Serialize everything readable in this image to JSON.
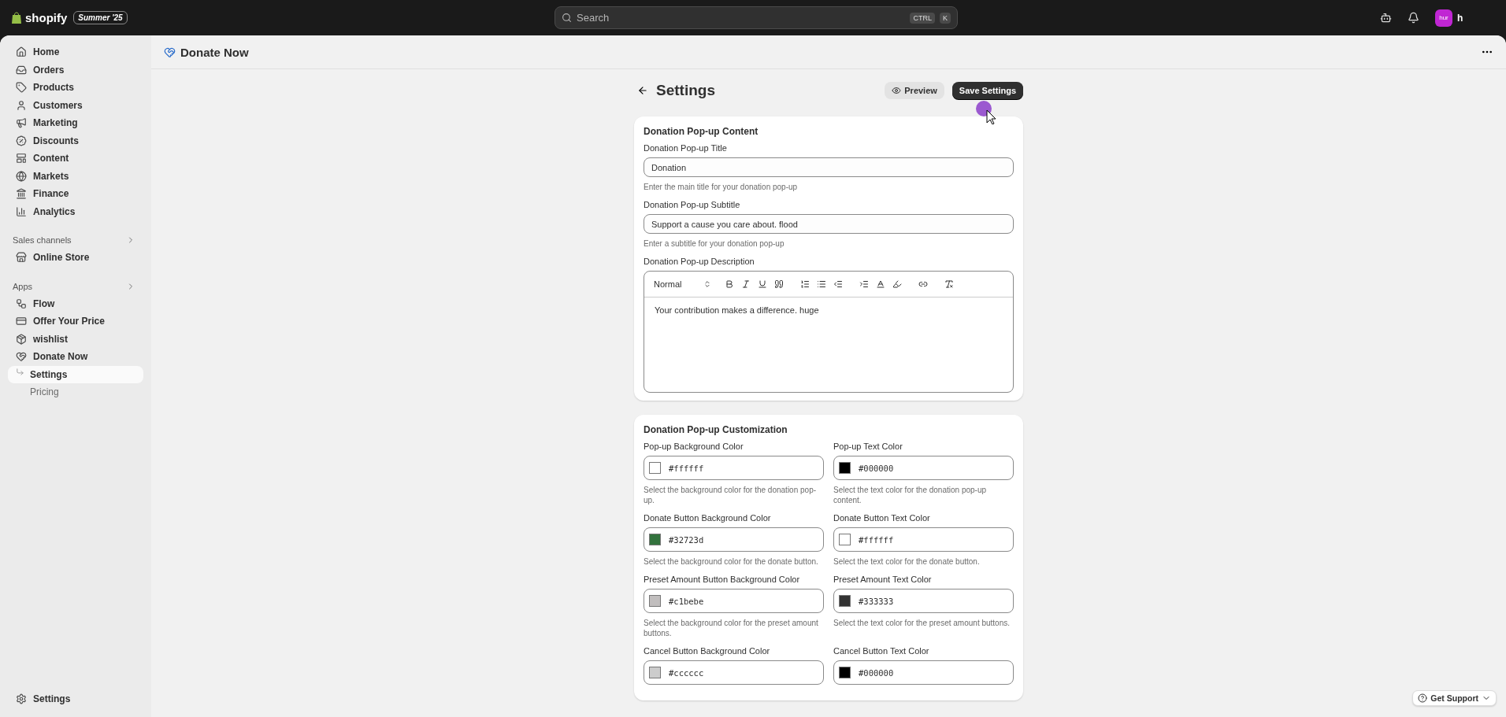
{
  "topbar": {
    "logo": "shopify",
    "badge": "Summer '25",
    "search": {
      "placeholder": "Search",
      "keys": [
        "CTRL",
        "K"
      ]
    },
    "avatar": "hur",
    "user": "h"
  },
  "sidebar": {
    "items": [
      {
        "label": "Home",
        "selected": false
      },
      {
        "label": "Orders",
        "selected": false
      },
      {
        "label": "Products",
        "selected": false
      },
      {
        "label": "Customers",
        "selected": false
      },
      {
        "label": "Marketing",
        "selected": false
      },
      {
        "label": "Discounts",
        "selected": false
      },
      {
        "label": "Content",
        "selected": false
      },
      {
        "label": "Markets",
        "selected": false
      },
      {
        "label": "Finance",
        "selected": false
      },
      {
        "label": "Analytics",
        "selected": false
      }
    ],
    "sections": [
      {
        "title": "Sales channels",
        "items": [
          {
            "label": "Online Store",
            "selected": false
          }
        ]
      },
      {
        "title": "Apps",
        "items": [
          {
            "label": "Flow",
            "selected": false
          },
          {
            "label": "Offer Your Price",
            "selected": false
          },
          {
            "label": "wishlist",
            "selected": false
          },
          {
            "label": "Donate Now",
            "selected": false,
            "children": [
              {
                "label": "Settings",
                "selected": true
              },
              {
                "label": "Pricing",
                "selected": false
              }
            ]
          }
        ]
      }
    ],
    "footer": {
      "label": "Settings",
      "selected": false
    }
  },
  "app_title": "Donate Now",
  "header": {
    "title": "Settings",
    "preview": "Preview",
    "save": "Save Settings"
  },
  "content_card": {
    "title": "Donation Pop-up Content",
    "fields": [
      {
        "label": "Donation Pop-up Title",
        "value": "Donation",
        "help": "Enter the main title for your donation pop-up"
      },
      {
        "label": "Donation Pop-up Subtitle",
        "value": "Support a cause you care about. flood",
        "help": "Enter a subtitle for your donation pop-up"
      }
    ],
    "editor": {
      "label": "Donation Pop-up Description",
      "format": "Normal",
      "text": "Your contribution makes a difference. huge"
    }
  },
  "customization_card": {
    "title": "Donation Pop-up Customization",
    "fields": [
      {
        "label": "Pop-up Background Color",
        "value": "#ffffff",
        "color": "#ffffff",
        "help": "Select the background color for the donation pop-up."
      },
      {
        "label": "Pop-up Text Color",
        "value": "#000000",
        "color": "#000000",
        "help": "Select the text color for the donation pop-up content."
      },
      {
        "label": "Donate Button Background Color",
        "value": "#32723d",
        "color": "#32723d",
        "help": "Select the background color for the donate button."
      },
      {
        "label": "Donate Button Text Color",
        "value": "#ffffff",
        "color": "#ffffff",
        "help": "Select the text color for the donate button."
      },
      {
        "label": "Preset Amount Button Background Color",
        "value": "#c1bebe",
        "color": "#c1bebe",
        "help": "Select the background color for the preset amount buttons."
      },
      {
        "label": "Preset Amount Text Color",
        "value": "#333333",
        "color": "#333333",
        "help": "Select the text color for the preset amount buttons."
      },
      {
        "label": "Cancel Button Background Color",
        "value": "#cccccc",
        "color": "#cccccc"
      },
      {
        "label": "Cancel Button Text Color",
        "value": "#000000",
        "color": "#000000"
      }
    ]
  },
  "support": {
    "label": "Get Support"
  }
}
